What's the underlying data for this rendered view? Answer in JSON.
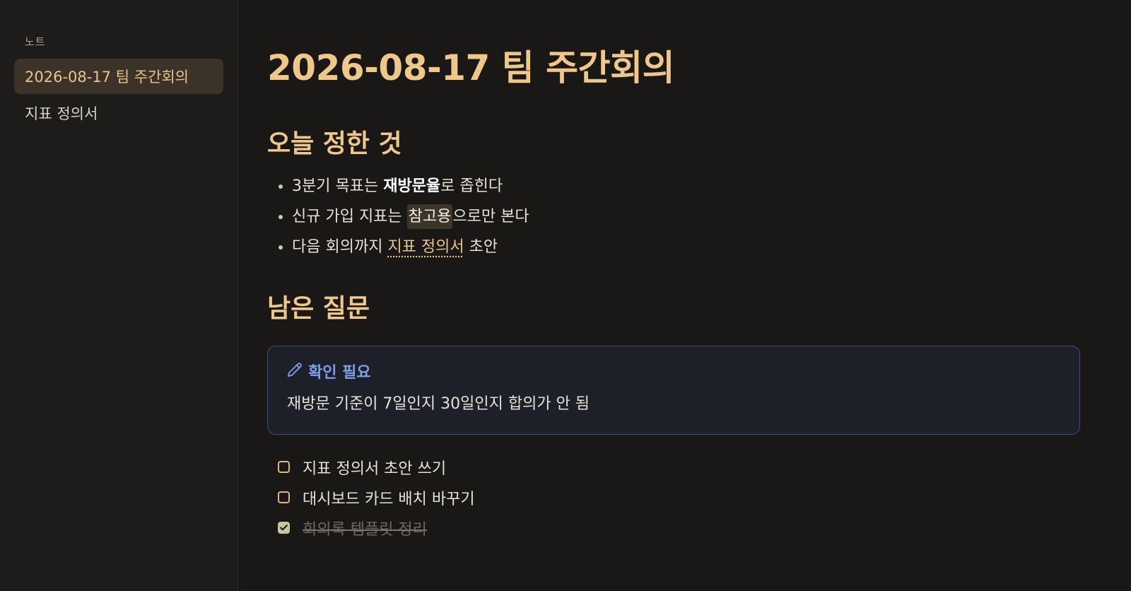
{
  "sidebar": {
    "heading": "노트",
    "items": [
      {
        "label": "2026-08-17 팀 주간회의",
        "active": true
      },
      {
        "label": "지표 정의서",
        "active": false
      }
    ]
  },
  "note": {
    "title": "2026-08-17 팀 주간회의",
    "sections": [
      {
        "heading": "오늘 정한 것",
        "bullets": [
          {
            "before": "3분기 목표는 ",
            "strong": "재방문율",
            "after": "로 좁힌다"
          },
          {
            "before": "신규 가입 지표는 ",
            "highlight": "참고용",
            "after": "으로만 본다"
          },
          {
            "before": "다음 회의까지 ",
            "link": "지표 정의서",
            "after": " 초안"
          }
        ]
      },
      {
        "heading": "남은 질문"
      }
    ],
    "callout": {
      "icon": "pencil-icon",
      "title": "확인 필요",
      "body": "재방문 기준이 7일인지 30일인지 합의가 안 됨"
    },
    "tasks": [
      {
        "label": "지표 정의서 초안 쓰기",
        "checked": false
      },
      {
        "label": "대시보드 카드 배치 바꾸기",
        "checked": false
      },
      {
        "label": "회의록 템플릿 정리",
        "checked": true
      }
    ]
  },
  "colors": {
    "accent": "#efc78a",
    "callout_accent": "#7e9fe6",
    "background": "#1a1817",
    "sidebar_background": "#1e1c1b",
    "checkbox_done": "#c7c79a"
  }
}
